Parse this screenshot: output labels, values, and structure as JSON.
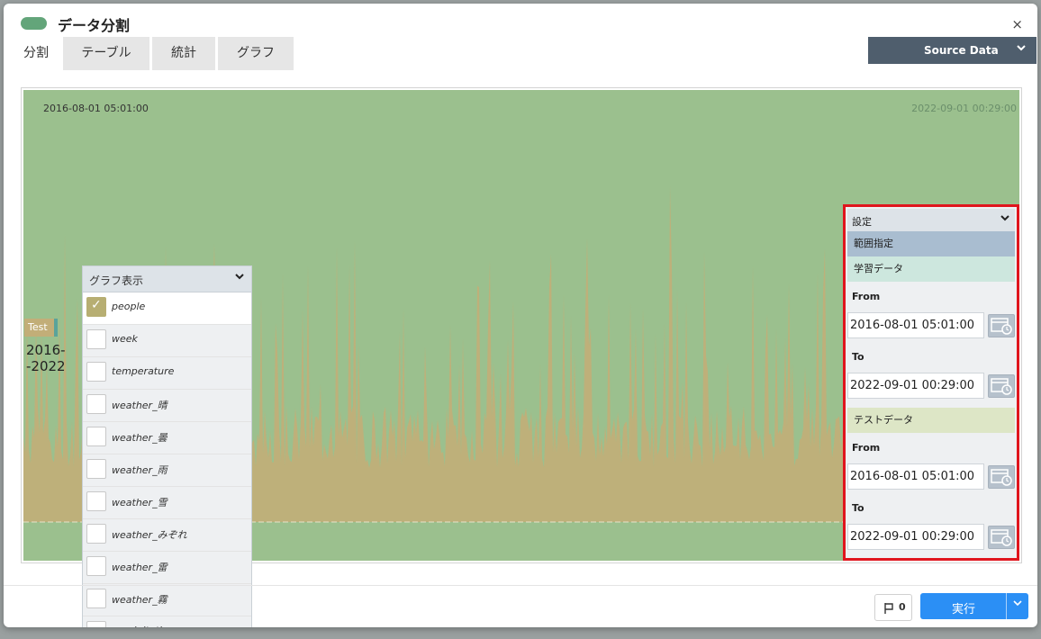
{
  "dialog": {
    "title": "データ分割",
    "close_label": "×",
    "accent_color": "#63a57a"
  },
  "tabs": [
    {
      "label": "分割",
      "active": true
    },
    {
      "label": "テーブル",
      "active": false
    },
    {
      "label": "統計",
      "active": false
    },
    {
      "label": "グラフ",
      "active": false
    }
  ],
  "source_dropdown": {
    "label": "Source Data"
  },
  "chart": {
    "start_date": "2016-08-01 05:01:00",
    "end_date": "2022-09-01 00:29:00",
    "background_color": "#9bc08e",
    "series_color": "#c2ae78",
    "test_label": "Test",
    "test_range_line1": "2016-",
    "test_range_line2": "-2022"
  },
  "graph_panel": {
    "header": "グラフ表示",
    "items": [
      {
        "label": "people",
        "checked": true
      },
      {
        "label": "week",
        "checked": false
      },
      {
        "label": "temperature",
        "checked": false
      },
      {
        "label": "weather_晴",
        "checked": false
      },
      {
        "label": "weather_曇",
        "checked": false
      },
      {
        "label": "weather_雨",
        "checked": false
      },
      {
        "label": "weather_雪",
        "checked": false
      },
      {
        "label": "weather_みぞれ",
        "checked": false
      },
      {
        "label": "weather_雷",
        "checked": false
      },
      {
        "label": "weather_霧",
        "checked": false
      },
      {
        "label": "precipitation",
        "checked": false
      }
    ]
  },
  "settings_panel": {
    "header": "設定",
    "range_label": "範囲指定",
    "train_label": "学習データ",
    "test_label": "テストデータ",
    "from_label": "From",
    "to_label": "To",
    "train_from": "2016-08-01 05:01:00",
    "train_to": "2022-09-01 00:29:00",
    "test_from": "2016-08-01 05:01:00",
    "test_to": "2022-09-01 00:29:00",
    "highlight_color": "#e0151d"
  },
  "footer": {
    "flag_count": "0",
    "run_label": "実行",
    "run_color": "#2b8ff5"
  }
}
